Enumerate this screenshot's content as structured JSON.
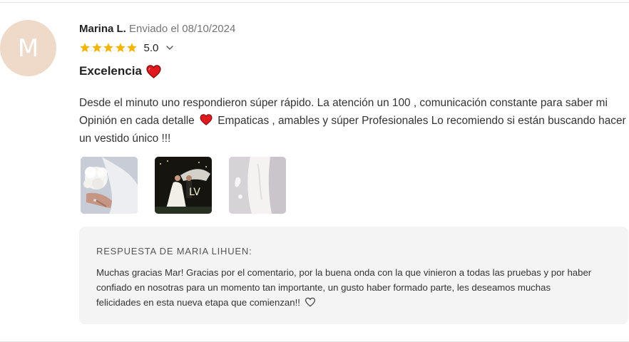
{
  "review": {
    "avatar_initial": "M",
    "author": "Marina L.",
    "date_text": "Enviado el 08/10/2024",
    "rating": 5,
    "rating_display": "5.0",
    "title": "Excelencia",
    "body_part1": "Desde el minuto uno respondieron súper rápido. La atención un 100 , comunicación constante para saber mi Opinión en cada detalle",
    "body_part2": "Empaticas , amables y súper Profesionales Lo recomiendo si están buscando hacer un vestido único !!!",
    "photos": [
      {
        "icon": "bridal-bouquet-photo"
      },
      {
        "icon": "wedding-couple-night-photo"
      },
      {
        "icon": "bridal-dress-detail-photo"
      }
    ]
  },
  "reply": {
    "label": "RESPUESTA DE MARIA LIHUEN:",
    "text": "Muchas gracias Mar! Gracias por el comentario, por la buena onda con la que vinieron a todas las pruebas y por haber confiado en nosotras para un momento tan importante, un gusto haber formado parte, les deseamos muchas felicidades en esta nueva etapa que comienzan!!"
  },
  "colors": {
    "star": "#f4b400",
    "heart": "#e0191f",
    "avatar_bg": "#efd9c8",
    "reply_bg": "#f4f4f4"
  }
}
